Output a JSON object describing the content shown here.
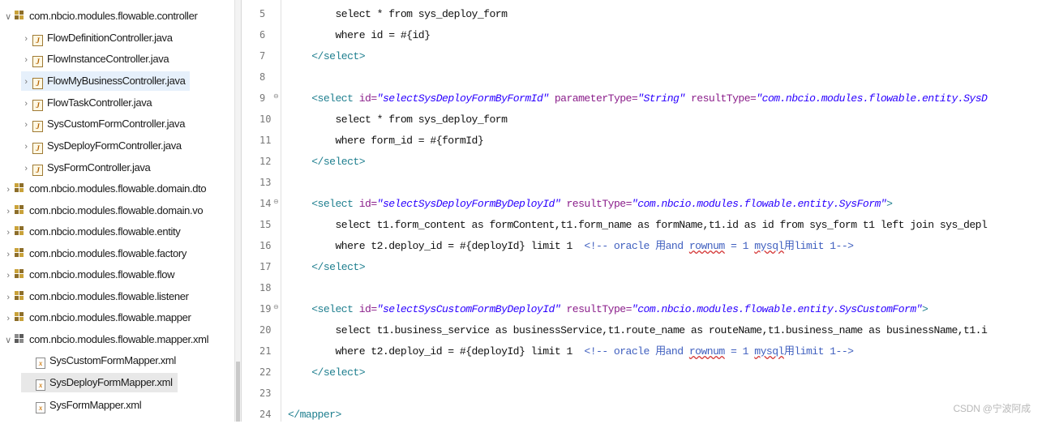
{
  "package_explorer": {
    "items": [
      {
        "kind": "package",
        "label": "com.nbcio.modules.flowable.controller",
        "expanded": true,
        "arrow": "∨"
      },
      {
        "kind": "java",
        "label": "FlowDefinitionController.java",
        "arrow": "›"
      },
      {
        "kind": "java",
        "label": "FlowInstanceController.java",
        "arrow": "›"
      },
      {
        "kind": "java",
        "label": "FlowMyBusinessController.java",
        "arrow": "›",
        "selected": true
      },
      {
        "kind": "java",
        "label": "FlowTaskController.java",
        "arrow": "›"
      },
      {
        "kind": "java",
        "label": "SysCustomFormController.java",
        "arrow": "›"
      },
      {
        "kind": "java",
        "label": "SysDeployFormController.java",
        "arrow": "›"
      },
      {
        "kind": "java",
        "label": "SysFormController.java",
        "arrow": "›"
      },
      {
        "kind": "package",
        "label": "com.nbcio.modules.flowable.domain.dto",
        "arrow": "›"
      },
      {
        "kind": "package",
        "label": "com.nbcio.modules.flowable.domain.vo",
        "arrow": "›"
      },
      {
        "kind": "package",
        "label": "com.nbcio.modules.flowable.entity",
        "arrow": "›"
      },
      {
        "kind": "package",
        "label": "com.nbcio.modules.flowable.factory",
        "arrow": "›"
      },
      {
        "kind": "package",
        "label": "com.nbcio.modules.flowable.flow",
        "arrow": "›"
      },
      {
        "kind": "package",
        "label": "com.nbcio.modules.flowable.listener",
        "arrow": "›"
      },
      {
        "kind": "package",
        "label": "com.nbcio.modules.flowable.mapper",
        "arrow": "›"
      },
      {
        "kind": "package-res",
        "label": "com.nbcio.modules.flowable.mapper.xml",
        "expanded": true,
        "arrow": "∨"
      },
      {
        "kind": "xml",
        "label": "SysCustomFormMapper.xml"
      },
      {
        "kind": "xml",
        "label": "SysDeployFormMapper.xml",
        "highlighted": true
      },
      {
        "kind": "xml",
        "label": "SysFormMapper.xml"
      }
    ]
  },
  "editor": {
    "lines": [
      {
        "n": "5",
        "segs": [
          {
            "c": "txt",
            "t": "        select * from sys_deploy_form"
          }
        ]
      },
      {
        "n": "6",
        "segs": [
          {
            "c": "txt",
            "t": "        where id = #{id}"
          }
        ]
      },
      {
        "n": "7",
        "segs": [
          {
            "c": "tag",
            "t": "    </select>"
          }
        ]
      },
      {
        "n": "8",
        "segs": []
      },
      {
        "n": "9",
        "fold": true,
        "segs": [
          {
            "c": "tag",
            "t": "    <select "
          },
          {
            "c": "attr",
            "t": "id="
          },
          {
            "c": "val",
            "t": "\"selectSysDeployFormByFormId\""
          },
          {
            "c": "attr",
            "t": " parameterType="
          },
          {
            "c": "val",
            "t": "\"String\""
          },
          {
            "c": "attr",
            "t": " resultType="
          },
          {
            "c": "val",
            "t": "\"com.nbcio.modules.flowable.entity.SysD"
          }
        ]
      },
      {
        "n": "10",
        "segs": [
          {
            "c": "txt",
            "t": "        select * from sys_deploy_form"
          }
        ]
      },
      {
        "n": "11",
        "segs": [
          {
            "c": "txt",
            "t": "        where form_id = #{formId}"
          }
        ]
      },
      {
        "n": "12",
        "segs": [
          {
            "c": "tag",
            "t": "    </select>"
          }
        ]
      },
      {
        "n": "13",
        "segs": []
      },
      {
        "n": "14",
        "fold": true,
        "segs": [
          {
            "c": "tag",
            "t": "    <select "
          },
          {
            "c": "attr",
            "t": "id="
          },
          {
            "c": "val",
            "t": "\"selectSysDeployFormByDeployId\""
          },
          {
            "c": "attr",
            "t": " resultType="
          },
          {
            "c": "val",
            "t": "\"com.nbcio.modules.flowable.entity.SysForm\""
          },
          {
            "c": "tag",
            "t": ">"
          }
        ]
      },
      {
        "n": "15",
        "segs": [
          {
            "c": "txt",
            "t": "        select t1.form_content as formContent,t1.form_name as formName,t1.id as id from sys_form t1 left join sys_depl"
          }
        ]
      },
      {
        "n": "16",
        "segs": [
          {
            "c": "txt",
            "t": "        where t2.deploy_id = #{deployId} limit 1  "
          },
          {
            "c": "cmt",
            "t": "<!-- oracle 用and "
          },
          {
            "c": "sq",
            "t": "rownum"
          },
          {
            "c": "cmt",
            "t": " = 1 "
          },
          {
            "c": "sq",
            "t": "mysql"
          },
          {
            "c": "cmt",
            "t": "用limit 1-->"
          }
        ]
      },
      {
        "n": "17",
        "segs": [
          {
            "c": "tag",
            "t": "    </select>"
          }
        ]
      },
      {
        "n": "18",
        "segs": []
      },
      {
        "n": "19",
        "fold": true,
        "segs": [
          {
            "c": "tag",
            "t": "    <select "
          },
          {
            "c": "attr",
            "t": "id="
          },
          {
            "c": "val",
            "t": "\"selectSysCustomFormByDeployId\""
          },
          {
            "c": "attr",
            "t": " resultType="
          },
          {
            "c": "val",
            "t": "\"com.nbcio.modules.flowable.entity.SysCustomForm\""
          },
          {
            "c": "tag",
            "t": ">"
          }
        ]
      },
      {
        "n": "20",
        "segs": [
          {
            "c": "txt",
            "t": "        select t1.business_service as businessService,t1.route_name as routeName,t1.business_name as businessName,t1.i"
          }
        ]
      },
      {
        "n": "21",
        "segs": [
          {
            "c": "txt",
            "t": "        where t2.deploy_id = #{deployId} limit 1  "
          },
          {
            "c": "cmt",
            "t": "<!-- oracle 用and "
          },
          {
            "c": "sq",
            "t": "rownum"
          },
          {
            "c": "cmt",
            "t": " = 1 "
          },
          {
            "c": "sq",
            "t": "mysql"
          },
          {
            "c": "cmt",
            "t": "用limit 1-->"
          }
        ]
      },
      {
        "n": "22",
        "segs": [
          {
            "c": "tag",
            "t": "    </select>"
          }
        ]
      },
      {
        "n": "23",
        "segs": []
      },
      {
        "n": "24",
        "segs": [
          {
            "c": "tag",
            "t": "</mapper>"
          }
        ]
      }
    ]
  },
  "watermark": "CSDN @宁波阿成",
  "colors": {
    "tag": "#1f7f8f",
    "attribute": "#8b1f8b",
    "string": "#2a00ff",
    "comment": "#3f5fbf",
    "selection": "#e6f0fb"
  }
}
